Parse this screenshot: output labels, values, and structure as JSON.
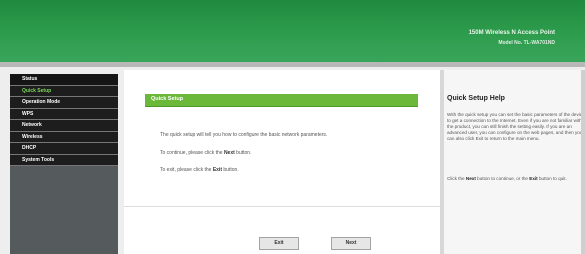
{
  "header": {
    "brand": "150M Wireless N Access Point",
    "model": "Model No. TL-WA701ND"
  },
  "sidebar": {
    "items": [
      {
        "label": "Status",
        "active": false
      },
      {
        "label": "Quick Setup",
        "active": true
      },
      {
        "label": "Operation Mode",
        "active": false
      },
      {
        "label": "WPS",
        "active": false
      },
      {
        "label": "Network",
        "active": false
      },
      {
        "label": "Wireless",
        "active": false
      },
      {
        "label": "DHCP",
        "active": false
      },
      {
        "label": "System Tools",
        "active": false
      }
    ]
  },
  "main": {
    "title": "Quick Setup",
    "line1": "The quick setup will tell you how to configure the basic network parameters.",
    "line2_prefix": "To continue, please click the ",
    "line2_bold": "Next",
    "line2_suffix": " button.",
    "line3_prefix": "To exit, please click the ",
    "line3_bold": "Exit",
    "line3_suffix": " button.",
    "exit_label": "Exit",
    "next_label": "Next"
  },
  "help": {
    "title": "Quick Setup Help",
    "text1": "With the quick setup you can set the basic parameters of the device to get a connection to the Internet. Even if you are not familiar with the product, you can still finish the setting easily. If you are an advanced user, you can configure on the web pages, and then you can also click Exit to return to the main menu.",
    "text2_prefix": "Click the ",
    "text2_bold1": "Next",
    "text2_mid": " button to continue, or the ",
    "text2_bold2": "Exit",
    "text2_suffix": " button to quit."
  },
  "colors": {
    "header_green": "#2e9c4d",
    "title_green": "#6cb83a",
    "menu_active": "#7fd65c",
    "menu_bg": "#1d1d1d"
  }
}
